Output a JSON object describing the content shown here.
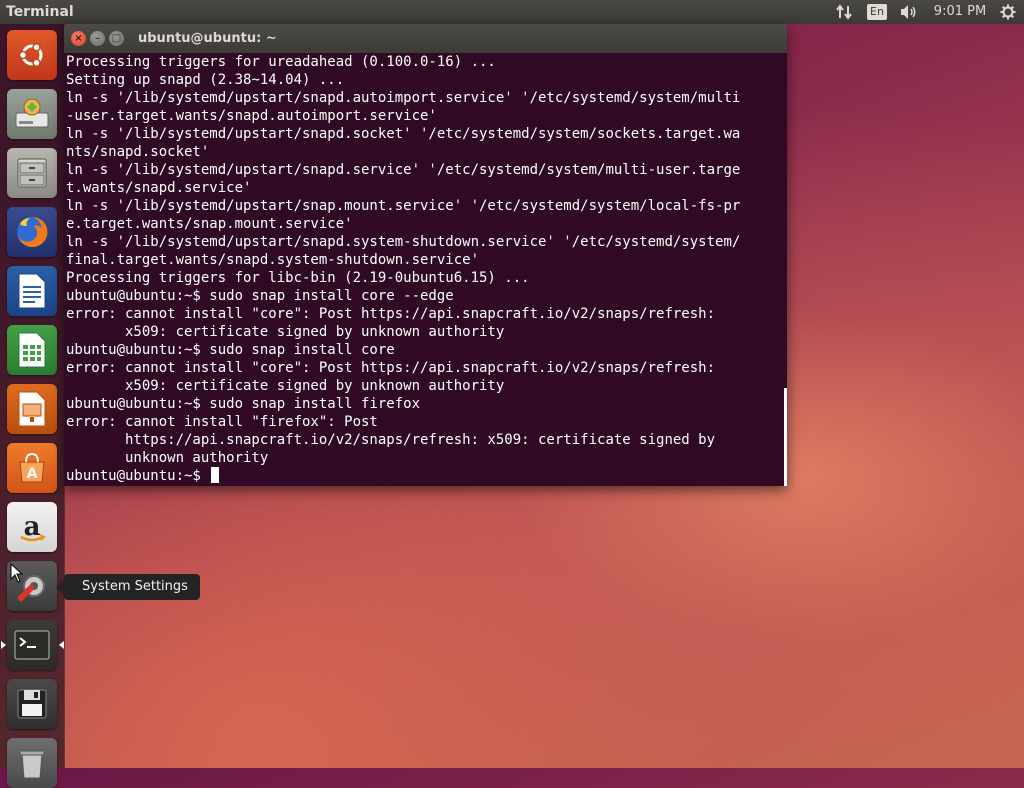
{
  "panel": {
    "app_title": "Terminal",
    "language": "En",
    "clock": "9:01 PM",
    "icons": [
      "network-icon",
      "keyboard-layout-indicator",
      "volume-icon",
      "session-gear-icon"
    ]
  },
  "launcher": {
    "items": [
      {
        "name": "ubuntu-dash-icon"
      },
      {
        "name": "disk-app-icon"
      },
      {
        "name": "files-icon"
      },
      {
        "name": "firefox-icon"
      },
      {
        "name": "libreoffice-writer-icon"
      },
      {
        "name": "libreoffice-calc-icon"
      },
      {
        "name": "libreoffice-impress-icon"
      },
      {
        "name": "software-center-icon"
      },
      {
        "name": "amazon-icon"
      },
      {
        "name": "system-settings-icon"
      },
      {
        "name": "terminal-icon"
      },
      {
        "name": "save-floppy-icon"
      },
      {
        "name": "trash-icon"
      }
    ],
    "tooltip": "System Settings"
  },
  "window": {
    "title": "ubuntu@ubuntu: ~",
    "colors": {
      "background": "#300a24",
      "text": "#ffffff"
    }
  },
  "terminal": {
    "lines": [
      "Processing triggers for ureadahead (0.100.0-16) ...",
      "Setting up snapd (2.38~14.04) ...",
      "ln -s '/lib/systemd/upstart/snapd.autoimport.service' '/etc/systemd/system/multi",
      "-user.target.wants/snapd.autoimport.service'",
      "ln -s '/lib/systemd/upstart/snapd.socket' '/etc/systemd/system/sockets.target.wa",
      "nts/snapd.socket'",
      "ln -s '/lib/systemd/upstart/snapd.service' '/etc/systemd/system/multi-user.targe",
      "t.wants/snapd.service'",
      "ln -s '/lib/systemd/upstart/snap.mount.service' '/etc/systemd/system/local-fs-pr",
      "e.target.wants/snap.mount.service'",
      "ln -s '/lib/systemd/upstart/snapd.system-shutdown.service' '/etc/systemd/system/",
      "final.target.wants/snapd.system-shutdown.service'",
      "Processing triggers for libc-bin (2.19-0ubuntu6.15) ...",
      "ubuntu@ubuntu:~$ sudo snap install core --edge",
      "error: cannot install \"core\": Post https://api.snapcraft.io/v2/snaps/refresh:",
      "       x509: certificate signed by unknown authority",
      "ubuntu@ubuntu:~$ sudo snap install core",
      "error: cannot install \"core\": Post https://api.snapcraft.io/v2/snaps/refresh:",
      "       x509: certificate signed by unknown authority",
      "ubuntu@ubuntu:~$ sudo snap install firefox",
      "error: cannot install \"firefox\": Post",
      "       https://api.snapcraft.io/v2/snaps/refresh: x509: certificate signed by",
      "       unknown authority"
    ],
    "prompt": "ubuntu@ubuntu:~$ "
  }
}
